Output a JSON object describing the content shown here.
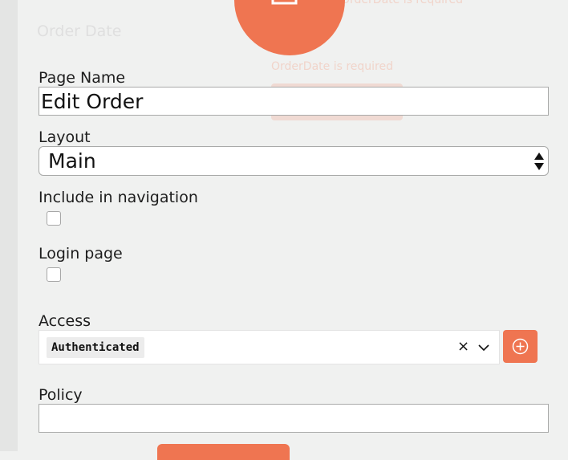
{
  "background": {
    "order_date_label": "Order Date",
    "required_message_top": "OrderDate is required",
    "required_message_mid": "OrderDate is required"
  },
  "form": {
    "page_name": {
      "label": "Page Name",
      "value": "Edit Order"
    },
    "layout": {
      "label": "Layout",
      "selected": "Main"
    },
    "include_in_navigation": {
      "label": "Include in navigation",
      "checked": false
    },
    "login_page": {
      "label": "Login page",
      "checked": false
    },
    "access": {
      "label": "Access",
      "selected_tag": "Authenticated",
      "clear_symbol": "×"
    },
    "policy": {
      "label": "Policy",
      "value": ""
    }
  },
  "colors": {
    "accent": "#ef7551",
    "background": "#f0f1f0",
    "input_border": "#a9aaa9"
  },
  "icons": {
    "top_circle": "edit-note-icon",
    "add_access": "plus-circle-icon",
    "dropdown": "chevron-down-icon",
    "select": "updown-arrows-icon"
  }
}
